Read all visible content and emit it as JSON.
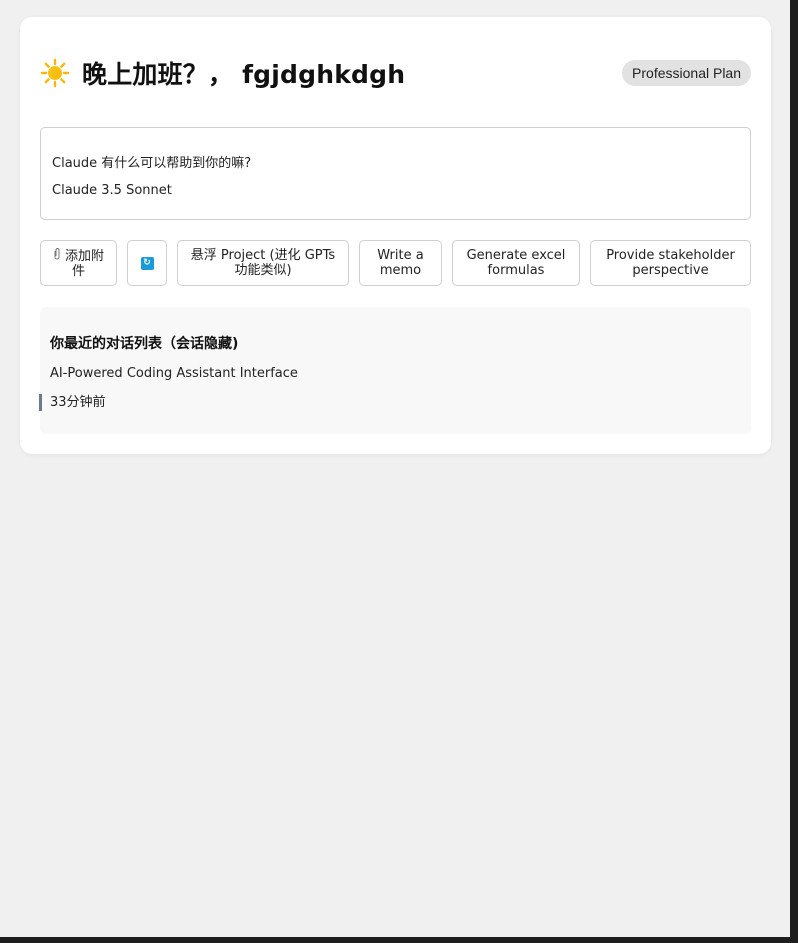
{
  "header": {
    "title": "晚上加班？， fgjdghkdgh",
    "plan_badge": "Professional Plan"
  },
  "prompt": {
    "placeholder": "Claude 有什么可以帮助到你的嘛?",
    "model": "Claude 3.5 Sonnet"
  },
  "actions": {
    "attach_label": "添加附件",
    "project_label": "悬浮 Project (进化 GPTs 功能类似)",
    "memo_label": "Write a memo",
    "excel_label": "Generate excel formulas",
    "stakeholder_label": "Provide stakeholder perspective"
  },
  "recent": {
    "title": "你最近的对话列表（会话隐藏)",
    "items": [
      {
        "title": "AI-Powered Coding Assistant Interface"
      }
    ],
    "time": "33分钟前"
  },
  "icons": {
    "title_icon": "sun-icon",
    "attach_icon": "paperclip-icon",
    "refresh_icon": "refresh-icon"
  },
  "colors": {
    "accent_blue": "#1a9bd7",
    "sun_yellow": "#f5b80b",
    "badge_bg": "#e2e2e2",
    "time_bar": "#6b7a8f"
  }
}
